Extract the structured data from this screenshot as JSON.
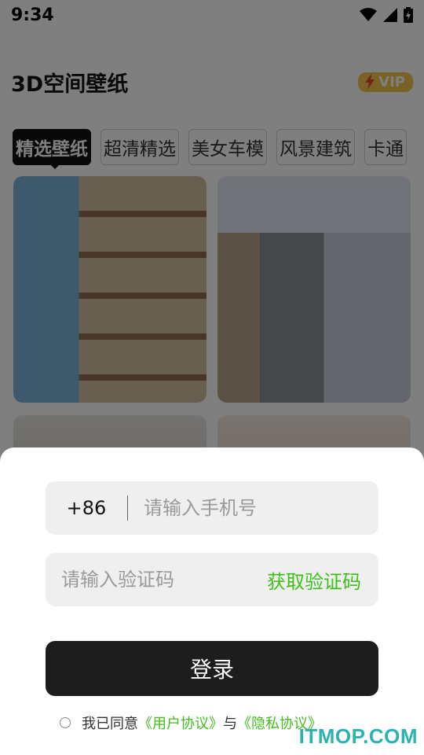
{
  "status": {
    "time": "9:34",
    "icons": [
      "wifi-icon",
      "cell-signal-icon",
      "battery-charging-icon"
    ]
  },
  "header": {
    "title": "3D空间壁纸",
    "vip_label": "VIP"
  },
  "tabs": [
    {
      "label": "精选壁纸",
      "active": true
    },
    {
      "label": "超清精选",
      "active": false
    },
    {
      "label": "美女车模",
      "active": false
    },
    {
      "label": "风景建筑",
      "active": false
    },
    {
      "label": "卡通",
      "active": false
    }
  ],
  "login": {
    "country_code": "+86",
    "phone_placeholder": "请输入手机号",
    "code_placeholder": "请输入验证码",
    "get_code_label": "获取验证码",
    "login_label": "登录",
    "agree_prefix": "我已同意",
    "user_agreement": "《用户协议》",
    "and": "与",
    "privacy_policy": "《隐私协议》"
  },
  "colors": {
    "accent_green": "#3fbf1a",
    "button_dark": "#1d1d1d",
    "vip_gold": "#f5c24a"
  },
  "watermark": "ITMOP.COM"
}
